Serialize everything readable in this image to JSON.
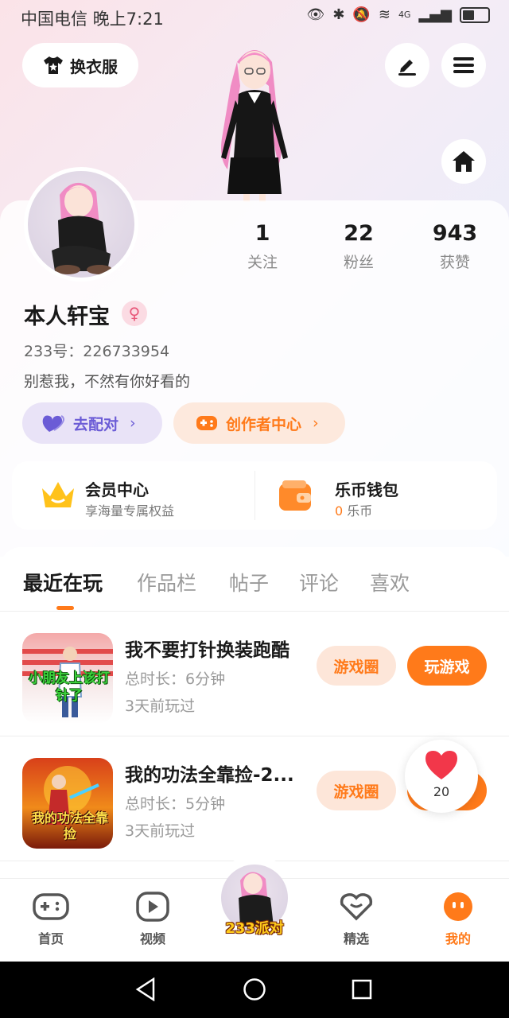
{
  "status_bar": {
    "carrier_time": "中国电信 晚上7:21",
    "network": "4G"
  },
  "header": {
    "dress_up_label": "换衣服"
  },
  "profile": {
    "stats": [
      {
        "value": "1",
        "label": "关注"
      },
      {
        "value": "22",
        "label": "粉丝"
      },
      {
        "value": "943",
        "label": "获赞"
      }
    ],
    "name": "本人轩宝",
    "gender_symbol": "♀",
    "uid": "233号：226733954",
    "bio": "别惹我，不然有你好看的"
  },
  "actions": {
    "match_label": "去配对",
    "creator_label": "创作者中心"
  },
  "vip": {
    "member_title": "会员中心",
    "member_sub": "享海量专属权益",
    "wallet_title": "乐币钱包",
    "wallet_amount": "0",
    "wallet_unit": "乐币"
  },
  "tabs": [
    "最近在玩",
    "作品栏",
    "帖子",
    "评论",
    "喜欢"
  ],
  "games": [
    {
      "title": "我不要打针换装跑酷",
      "duration": "总时长：6分钟",
      "last_played": "3天前玩过",
      "thumb_text": "小朋友上该打针了"
    },
    {
      "title": "我的功法全靠捡-2...",
      "duration": "总时长：5分钟",
      "last_played": "3天前玩过",
      "thumb_text": "我的功法全靠捡"
    }
  ],
  "game_buttons": {
    "circle": "游戏圈",
    "play": "玩游戏"
  },
  "like_float": {
    "count": "20"
  },
  "bottom_nav": [
    "首页",
    "视频",
    "233派对",
    "精选",
    "我的"
  ],
  "colors": {
    "accent": "#ff7a1a",
    "match_bg": "#e9e3f7",
    "match_text": "#6b5cd6"
  }
}
